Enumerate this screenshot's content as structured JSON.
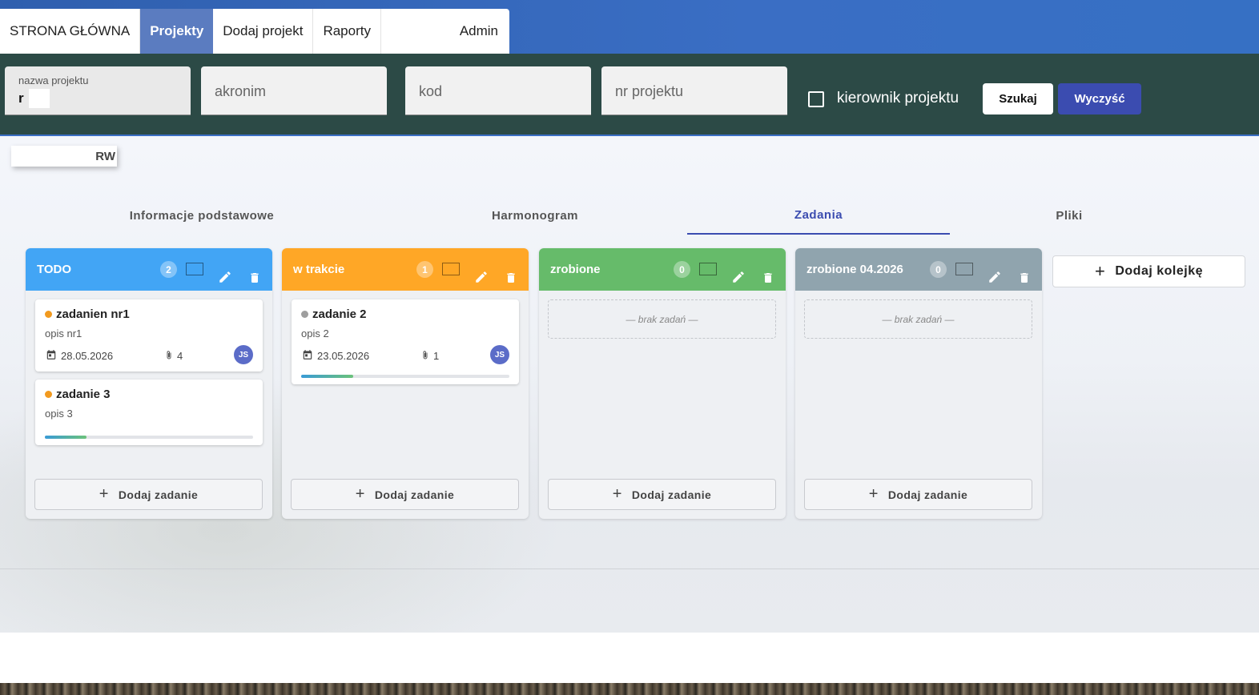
{
  "nav": {
    "items": [
      {
        "label": "STRONA GŁÓWNA",
        "active": false
      },
      {
        "label": "Projekty",
        "active": true
      },
      {
        "label": "Dodaj projekt",
        "active": false
      },
      {
        "label": "Raporty",
        "active": false
      }
    ],
    "user": "Admin"
  },
  "search": {
    "project_name_label": "nazwa projektu",
    "project_name_value": "r",
    "acronym_placeholder": "akronim",
    "code_placeholder": "kod",
    "number_placeholder": "nr projektu",
    "manager_checkbox_label": "kierownik projektu",
    "search_button": "Szukaj",
    "clear_button": "Wyczyść"
  },
  "project": {
    "chip_label": "RW"
  },
  "tabs": [
    {
      "label": "Informacje podstawowe",
      "active": false
    },
    {
      "label": "Harmonogram",
      "active": false
    },
    {
      "label": "Zadania",
      "active": true
    },
    {
      "label": "Pliki",
      "active": false
    }
  ],
  "board": {
    "add_task_label": "Dodaj zadanie",
    "add_queue_label": "Dodaj kolejkę",
    "empty_label": "— brak zadań —",
    "columns": [
      {
        "title": "TODO",
        "count": "2",
        "color": "#42a5f5",
        "cards": [
          {
            "title": "zadanien nr1",
            "description": "opis nr1",
            "date": "28.05.2026",
            "attachments": "4",
            "assignee": "JS",
            "dot_color": "#f29a1f"
          },
          {
            "title": "zadanie 3",
            "description": "opis 3",
            "progress": 0.2,
            "dot_color": "#f29a1f"
          }
        ]
      },
      {
        "title": "w trakcie",
        "count": "1",
        "color": "#ffa726",
        "cards": [
          {
            "title": "zadanie 2",
            "description": "opis 2",
            "date": "23.05.2026",
            "attachments": "1",
            "assignee": "JS",
            "progress": 0.25,
            "dot_color": "#9e9e9e"
          }
        ]
      },
      {
        "title": "zrobione",
        "count": "0",
        "color": "#66bb6a",
        "cards": []
      },
      {
        "title": "zrobione 04.2026",
        "count": "0",
        "color": "#90a4ae",
        "cards": []
      }
    ]
  }
}
